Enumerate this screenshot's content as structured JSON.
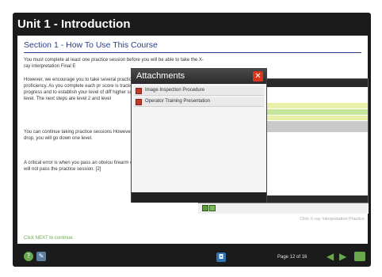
{
  "header": {
    "title": "Unit 1 - Introduction"
  },
  "section": {
    "title": "Section 1 - How To Use This Course"
  },
  "body": {
    "para1": "You must complete at least one practice session before you will be able to take the X-ray interpretation Final E",
    "para2": "However, we encourage you to take several practice sessions to improve your proficiency. As you complete each pr score is tracked. This tracking system is u progress and to establish your level of diff higher scores, you will move to a higher le level. The next steps are level 2 and level",
    "para3": "You can continue taking practice sessions However, if you commit a critical error or i drop, you will go down one level.",
    "para4": "A critical error is when you pass an obviou firearm or explosive device. If you make a will not pass the practice session. [2]",
    "next_hint": "Click NEXT to continue."
  },
  "background_window": {
    "caption": "Click X-ray Interpretation Practice",
    "colors": {
      "yellow": "#e8efa8",
      "green": "#c5e59a",
      "gray": "#c9c9c9"
    }
  },
  "dialog": {
    "title": "Attachments",
    "close_icon": "close-icon",
    "items": [
      {
        "label": "Image Inspection Procedure",
        "icon": "pdf-icon"
      },
      {
        "label": "Operator Training Presentation",
        "icon": "pdf-icon"
      }
    ]
  },
  "toolbar": {
    "help_glyph": "?",
    "page_indicator": "Page 12 of 16",
    "icons": [
      "help-icon",
      "edit-icon",
      "attachment-icon",
      "back-arrow-icon",
      "next-arrow-icon",
      "exit-icon"
    ]
  },
  "colors": {
    "accent": "#2a3f8f",
    "frame": "#1b1b1b",
    "green": "#6aa84f",
    "close_red": "#d9361c"
  }
}
